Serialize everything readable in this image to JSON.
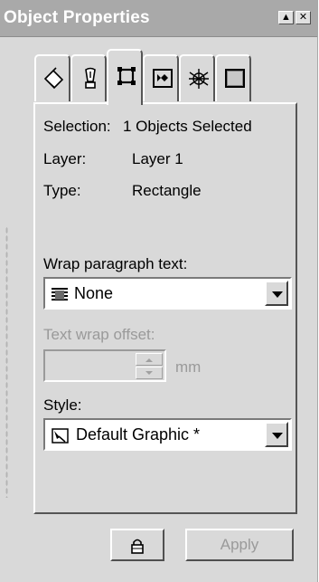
{
  "window": {
    "title": "Object Properties",
    "minimize_glyph": "▲",
    "close_glyph": "✕"
  },
  "tabs": [
    {
      "icon": "fill-bucket-icon"
    },
    {
      "icon": "pen-nib-icon"
    },
    {
      "icon": "rectangle-icon",
      "active": true
    },
    {
      "icon": "shape-frame-icon"
    },
    {
      "icon": "pattern-texture-icon"
    },
    {
      "icon": "square-fill-icon"
    }
  ],
  "info": {
    "selection_label": "Selection:",
    "selection_value": "1 Objects Selected",
    "layer_label": "Layer:",
    "layer_value": "Layer 1",
    "type_label": "Type:",
    "type_value": "Rectangle"
  },
  "wrap": {
    "label": "Wrap paragraph text:",
    "value": "None",
    "icon": "text-wrap-icon"
  },
  "offset": {
    "label": "Text wrap offset:",
    "value": "",
    "unit": "mm",
    "disabled": true
  },
  "style": {
    "label": "Style:",
    "value": "Default Graphic *",
    "icon": "graphic-style-icon"
  },
  "footer": {
    "lock_icon": "lock-icon",
    "apply_label": "Apply",
    "apply_disabled": true
  },
  "colors": {
    "titlebar": "#a9a9a9",
    "panel": "#d9d9d9",
    "disabled_text": "#9a9a9a"
  }
}
